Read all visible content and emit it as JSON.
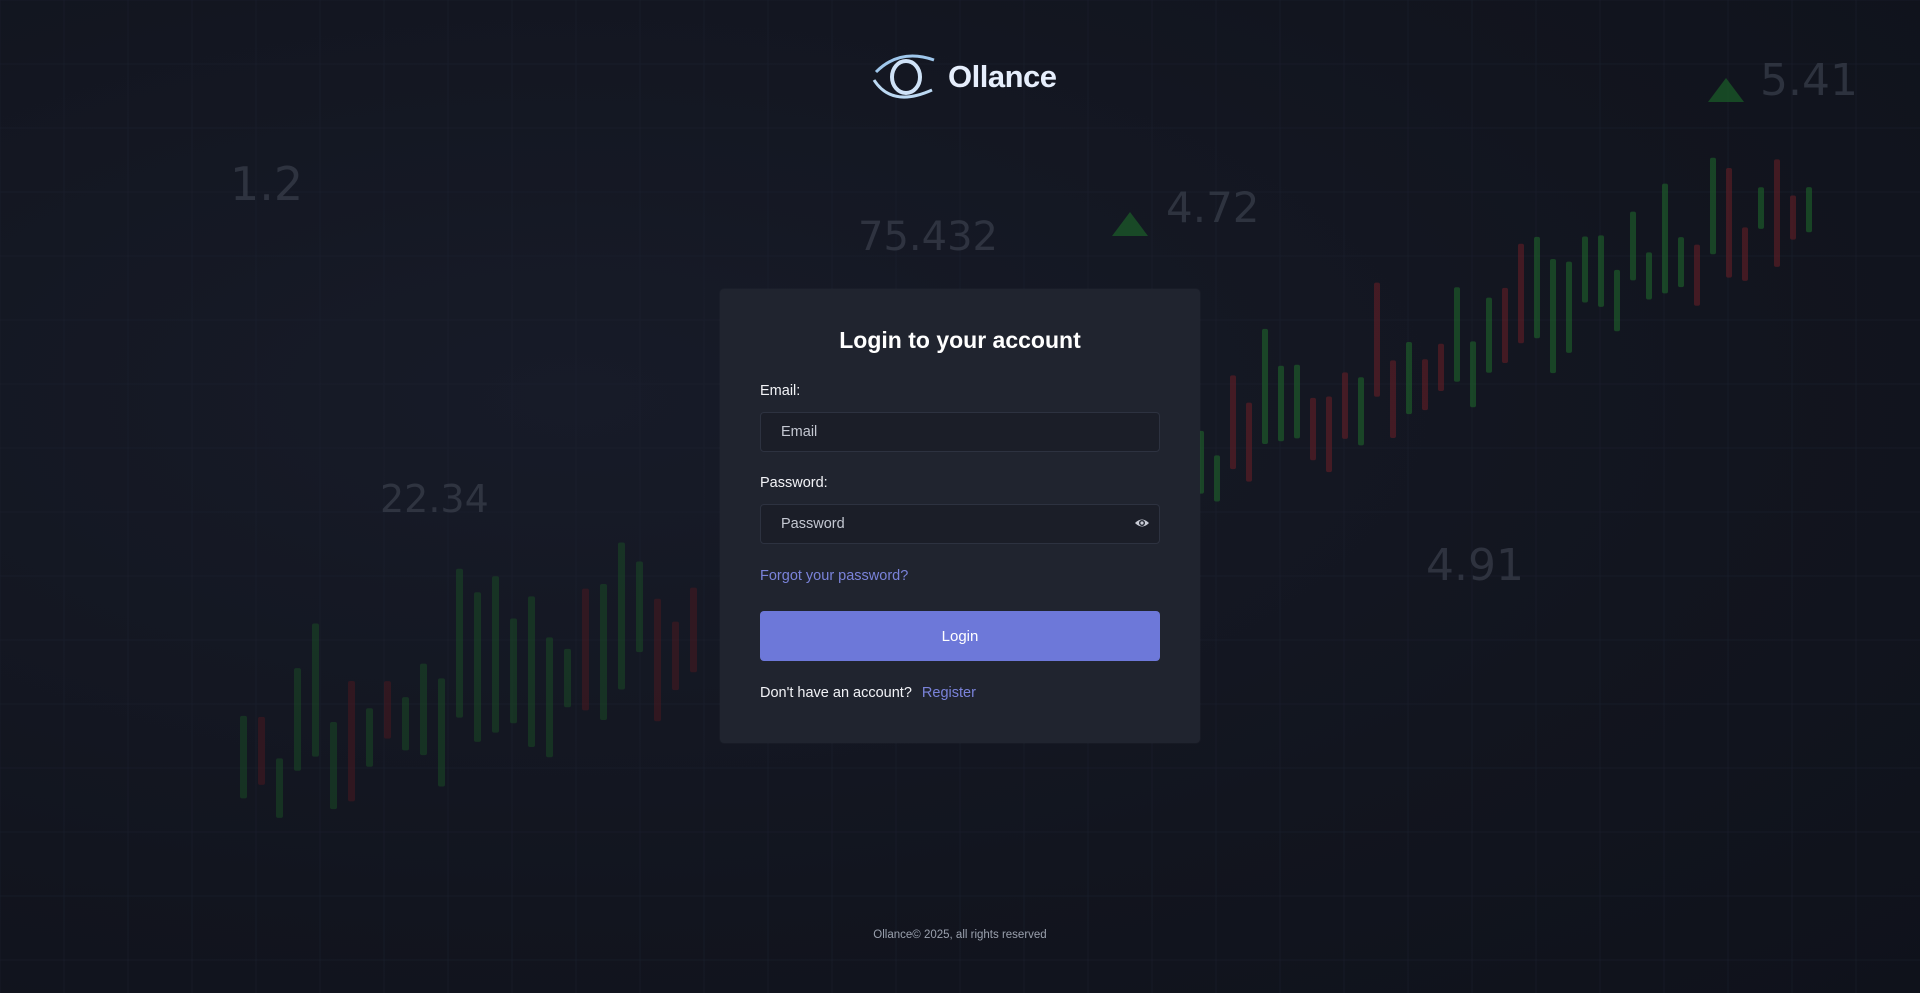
{
  "brand": {
    "name": "Ollance",
    "accent": "#6d78d9",
    "link_color": "#7a83da"
  },
  "background": {
    "numbers": [
      "75.432",
      "4.72",
      "5.41",
      "4.91",
      "22.34",
      "1.2"
    ]
  },
  "login": {
    "title": "Login to your account",
    "email_label": "Email:",
    "email_placeholder": "Email",
    "email_value": "",
    "password_label": "Password:",
    "password_placeholder": "Password",
    "password_value": "",
    "password_toggle_icon": "eye-icon",
    "forgot_link": "Forgot your password?",
    "submit_label": "Login",
    "no_account_text": "Don't have an account?",
    "register_link": "Register"
  },
  "footer": {
    "copyright": "Ollance© 2025, all rights reserved"
  }
}
